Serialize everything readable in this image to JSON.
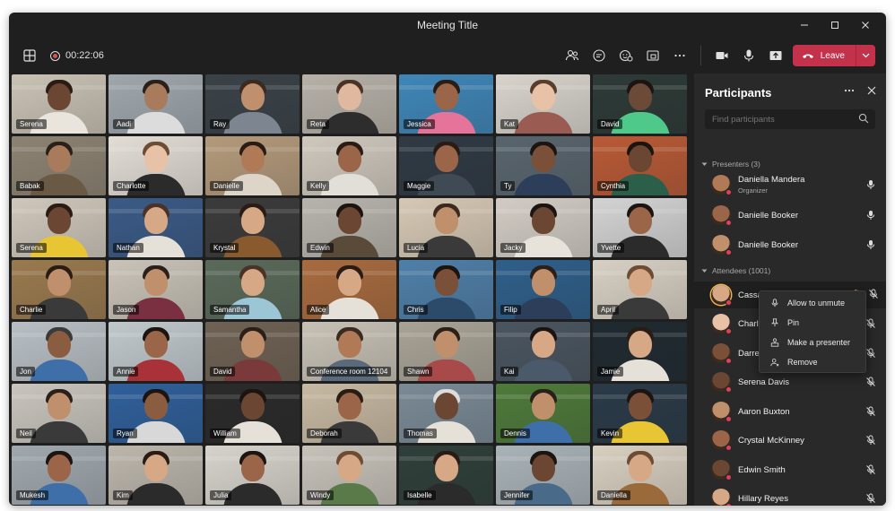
{
  "window": {
    "title": "Meeting Title",
    "controls": {
      "minimize_icon": "minimize-icon",
      "maximize_icon": "maximize-icon",
      "close_icon": "close-icon"
    }
  },
  "toolbar": {
    "timer": "00:22:06",
    "leave_label": "Leave"
  },
  "tiles": [
    {
      "name": "Serena",
      "bg": "#c9c2b4",
      "skin": "#6b4632",
      "hair": "#2a1c14",
      "shirt": "#e9e4dc"
    },
    {
      "name": "Aadi",
      "bg": "#9fa7ad",
      "skin": "#a87b5c",
      "hair": "#2b2019",
      "shirt": "#dcdcdc"
    },
    {
      "name": "Ray",
      "bg": "#3a4248",
      "skin": "#c08f6c",
      "hair": "#3a2a1f",
      "shirt": "#7d8590"
    },
    {
      "name": "Reta",
      "bg": "#b7b1a8",
      "skin": "#e0b8a0",
      "hair": "#4a3226",
      "shirt": "#2d2d2d"
    },
    {
      "name": "Jessica",
      "bg": "#3f86b8",
      "skin": "#9a6548",
      "hair": "#2b1c14",
      "shirt": "#e6739a"
    },
    {
      "name": "Kat",
      "bg": "#d8d4cc",
      "skin": "#e8c2a6",
      "hair": "#5a3c2a",
      "shirt": "#9a5b52"
    },
    {
      "name": "David",
      "bg": "#2d3a37",
      "skin": "#6c4a38",
      "hair": "#1c1410",
      "shirt": "#4ec98a"
    },
    {
      "name": "Babak",
      "bg": "#8d8373",
      "skin": "#a87b5c",
      "hair": "#2b2019",
      "shirt": "#6a5a45"
    },
    {
      "name": "Charlotte",
      "bg": "#e2ddd5",
      "skin": "#e8c2a6",
      "hair": "#6e4b33",
      "shirt": "#2b2b2b"
    },
    {
      "name": "Danielle",
      "bg": "#b49a7b",
      "skin": "#b07a56",
      "hair": "#2a1c14",
      "shirt": "#dcd5c8"
    },
    {
      "name": "Kelly",
      "bg": "#cfc8bd",
      "skin": "#9a6548",
      "hair": "#2a1c14",
      "shirt": "#e2ded8"
    },
    {
      "name": "Maggie",
      "bg": "#2f3a44",
      "skin": "#9a6548",
      "hair": "#2a1c14",
      "shirt": "#3f4a55"
    },
    {
      "name": "Ty",
      "bg": "#59656e",
      "skin": "#7a5038",
      "hair": "#1c1410",
      "shirt": "#2c3e5a"
    },
    {
      "name": "Cynthia",
      "bg": "#b85a36",
      "skin": "#6b4632",
      "hair": "#1c1410",
      "shirt": "#2b5f4a"
    },
    {
      "name": "Serena",
      "bg": "#cfc7bb",
      "skin": "#6b4632",
      "hair": "#2a1c14",
      "shirt": "#e8c533"
    },
    {
      "name": "Nathan",
      "bg": "#3a5a86",
      "skin": "#d6a886",
      "hair": "#4a3226",
      "shirt": "#e6e1d8"
    },
    {
      "name": "Krystal",
      "bg": "#3b3b3b",
      "skin": "#d6a886",
      "hair": "#2a1c14",
      "shirt": "#8a5a2f"
    },
    {
      "name": "Edwin",
      "bg": "#b8b4ad",
      "skin": "#6b4632",
      "hair": "#1c1410",
      "shirt": "#5a4a3a"
    },
    {
      "name": "Lucia",
      "bg": "#d6c8b4",
      "skin": "#c08f6c",
      "hair": "#3a2a1f",
      "shirt": "#3a3a3a"
    },
    {
      "name": "Jacky",
      "bg": "#d2ccc4",
      "skin": "#6b4632",
      "hair": "#1c1410",
      "shirt": "#e8e3da"
    },
    {
      "name": "Yvette",
      "bg": "#d3d3d3",
      "skin": "#9a6548",
      "hair": "#1c1410",
      "shirt": "#2b2b2b"
    },
    {
      "name": "Charlie",
      "bg": "#9a7a4f",
      "skin": "#c08f6c",
      "hair": "#2a1c14",
      "shirt": "#3a3a3a"
    },
    {
      "name": "Jason",
      "bg": "#c9c3b8",
      "skin": "#c08f6c",
      "hair": "#2b2019",
      "shirt": "#7a3040"
    },
    {
      "name": "Samantha",
      "bg": "#5a6a5a",
      "skin": "#d6a886",
      "hair": "#4a3226",
      "shirt": "#9cc6d6"
    },
    {
      "name": "Alice",
      "bg": "#a86b3f",
      "skin": "#d6a886",
      "hair": "#2a1c14",
      "shirt": "#e6e1d8"
    },
    {
      "name": "Chris",
      "bg": "#4f7fa8",
      "skin": "#7a5038",
      "hair": "#1c1410",
      "shirt": "#2c4a6a"
    },
    {
      "name": "Filip",
      "bg": "#2f5f8a",
      "skin": "#c08f6c",
      "hair": "#2b2019",
      "shirt": "#2c3e5a"
    },
    {
      "name": "April",
      "bg": "#d7d0c4",
      "skin": "#d6a886",
      "hair": "#6e4b33",
      "shirt": "#3a3a3a"
    },
    {
      "name": "Jon",
      "bg": "#b8bfc4",
      "skin": "#8a5c40",
      "hair": "#3a3a3a",
      "shirt": "#3f6fa8"
    },
    {
      "name": "Annie",
      "bg": "#c0c8cc",
      "skin": "#9a6548",
      "hair": "#1c1410",
      "shirt": "#a83238"
    },
    {
      "name": "David",
      "bg": "#6f6254",
      "skin": "#c08f6c",
      "hair": "#2b2019",
      "shirt": "#7a3a3a"
    },
    {
      "name": "Conference room 12104",
      "bg": "#c7c1b5",
      "skin": "#b07a56",
      "hair": "#3a2a1f",
      "shirt": "#5a6a7a"
    },
    {
      "name": "Shawn",
      "bg": "#a9a396",
      "skin": "#c08f6c",
      "hair": "#2b2019",
      "shirt": "#a84a4a"
    },
    {
      "name": "Kai",
      "bg": "#4a5560",
      "skin": "#d6a886",
      "hair": "#1c1410",
      "shirt": "#4a5a6a"
    },
    {
      "name": "Jamie",
      "bg": "#1f2a30",
      "skin": "#d6a886",
      "hair": "#2a1c14",
      "shirt": "#e6e1d8"
    },
    {
      "name": "Neil",
      "bg": "#c9c5bd",
      "skin": "#c08f6c",
      "hair": "#2b2019",
      "shirt": "#3a3a3a"
    },
    {
      "name": "Ryan",
      "bg": "#2f5f9a",
      "skin": "#8a5c40",
      "hair": "#1c1410",
      "shirt": "#d8d8d8"
    },
    {
      "name": "William",
      "bg": "#2a2a2a",
      "skin": "#6b4632",
      "hair": "#1c1410",
      "shirt": "#e6e1d8"
    },
    {
      "name": "Deborah",
      "bg": "#c7b9a2",
      "skin": "#9a6548",
      "hair": "#2a1c14",
      "shirt": "#3a3a3a"
    },
    {
      "name": "Thomas",
      "bg": "#7a8a96",
      "skin": "#6b4632",
      "hair": "#dcdcdc",
      "shirt": "#e6e1d8"
    },
    {
      "name": "Dennis",
      "bg": "#4e7a3a",
      "skin": "#c08f6c",
      "hair": "#2b2019",
      "shirt": "#3f6fa8"
    },
    {
      "name": "Kevin",
      "bg": "#2a3a48",
      "skin": "#7a5038",
      "hair": "#1c1410",
      "shirt": "#e8c533"
    },
    {
      "name": "Mukesh",
      "bg": "#a0a8ae",
      "skin": "#9a6548",
      "hair": "#1c1410",
      "shirt": "#3f6fa8"
    },
    {
      "name": "Kim",
      "bg": "#bcb6ac",
      "skin": "#d6a886",
      "hair": "#2a1c14",
      "shirt": "#2b2b2b"
    },
    {
      "name": "Julia",
      "bg": "#d7d3cc",
      "skin": "#9a6548",
      "hair": "#1c1410",
      "shirt": "#2b2b2b"
    },
    {
      "name": "Windy",
      "bg": "#c7c2b9",
      "skin": "#d6a886",
      "hair": "#6e4b33",
      "shirt": "#5a7a4a"
    },
    {
      "name": "Isabelle",
      "bg": "#2f3f3a",
      "skin": "#d6a886",
      "hair": "#2a1c14",
      "shirt": "#2b2b2b"
    },
    {
      "name": "Jennifer",
      "bg": "#a9b3b8",
      "skin": "#6b4632",
      "hair": "#1c1410",
      "shirt": "#4a6a8a"
    },
    {
      "name": "Daniella",
      "bg": "#d8cfc0",
      "skin": "#d6a886",
      "hair": "#6e4b33",
      "shirt": "#9a6a3a"
    }
  ],
  "panel": {
    "title": "Participants",
    "search_placeholder": "Find participants",
    "presenters_label": "Presenters (3)",
    "attendees_label": "Attendees (1001)",
    "presenters": [
      {
        "name": "Daniella Mandera",
        "role": "Organizer",
        "avatar": "#b07a56",
        "mic": "mic"
      },
      {
        "name": "Danielle Booker",
        "role": "",
        "avatar": "#9a6548",
        "mic": "mic"
      },
      {
        "name": "Danielle Booker",
        "role": "",
        "avatar": "#c08f6c",
        "mic": "mic"
      }
    ],
    "attendees": [
      {
        "name": "Cassandra Dunn",
        "avatar": "#d6a886",
        "mic": "mic-off",
        "selected": true
      },
      {
        "name": "Charlotte",
        "avatar": "#e8c2a6",
        "mic": "mic-off",
        "selected": false
      },
      {
        "name": "Darren M",
        "avatar": "#7a5038",
        "mic": "mic-off",
        "selected": false
      },
      {
        "name": "Serena Davis",
        "avatar": "#6b4632",
        "mic": "mic-off",
        "selected": false
      },
      {
        "name": "Aaron Buxton",
        "avatar": "#c08f6c",
        "mic": "mic-off",
        "selected": false
      },
      {
        "name": "Crystal McKinney",
        "avatar": "#9a6548",
        "mic": "mic-off",
        "selected": false
      },
      {
        "name": "Edwin Smith",
        "avatar": "#6b4632",
        "mic": "mic-off",
        "selected": false
      },
      {
        "name": "Hillary Reyes",
        "avatar": "#d6a886",
        "mic": "mic-off",
        "selected": false
      }
    ]
  },
  "context_menu": {
    "items": [
      {
        "label": "Allow to unmute",
        "icon": "mic-icon"
      },
      {
        "label": "Pin",
        "icon": "pin-icon"
      },
      {
        "label": "Make a presenter",
        "icon": "presenter-icon"
      },
      {
        "label": "Remove",
        "icon": "remove-user-icon"
      }
    ]
  },
  "colors": {
    "accent_leave": "#c4314b",
    "presence_busy": "#e0405a",
    "window_bg": "#1f1f1f",
    "panel_bg": "#292929"
  }
}
